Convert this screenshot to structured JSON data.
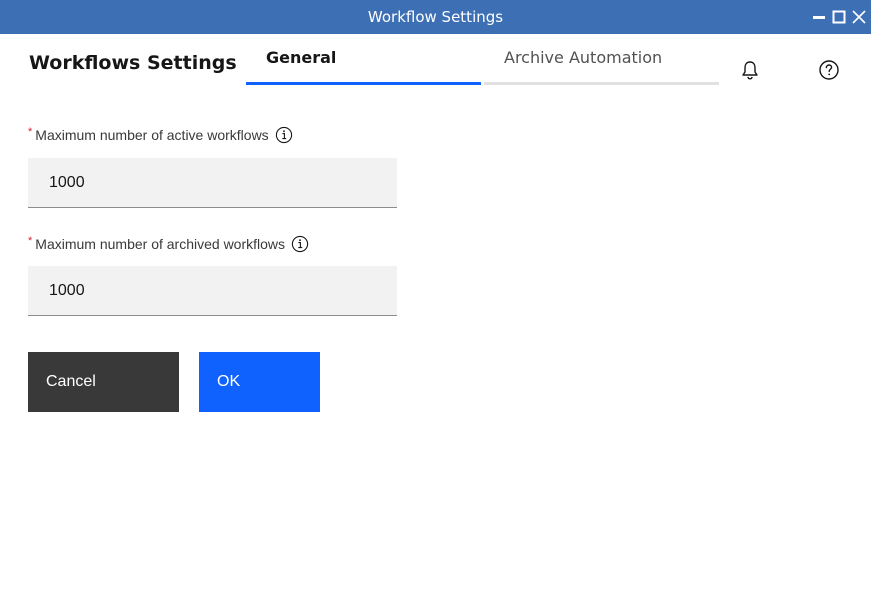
{
  "window": {
    "title": "Workflow Settings"
  },
  "header": {
    "app_title": "Workflows Settings",
    "tabs": [
      {
        "label": "General",
        "selected": true
      },
      {
        "label": "Archive Automation",
        "selected": false
      }
    ],
    "icons": [
      "bell-icon",
      "help-icon"
    ]
  },
  "form": {
    "required_marker": "*",
    "fields": [
      {
        "label": "Maximum number of active workflows",
        "value": "1000"
      },
      {
        "label": "Maximum number of archived workflows",
        "value": "1000"
      }
    ]
  },
  "actions": {
    "cancel_label": "Cancel",
    "ok_label": "OK"
  },
  "colors": {
    "titlebar": "#3d6fb4",
    "accent": "#0f62fe",
    "cancel": "#393939",
    "required": "#da1e28"
  }
}
